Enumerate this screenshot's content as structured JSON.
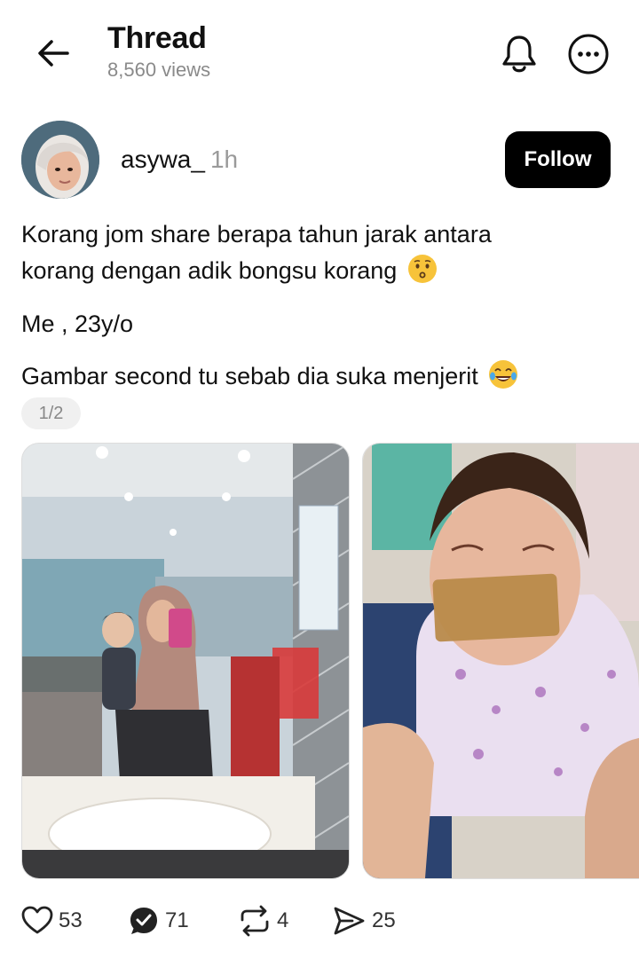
{
  "header": {
    "title": "Thread",
    "views": "8,560 views"
  },
  "author": {
    "username": "asywa_",
    "time": "1h",
    "follow_label": "Follow"
  },
  "post": {
    "line1": "Korang jom share berapa tahun jarak antara",
    "line2": "korang dengan adik bongsu korang",
    "line3": "Me , 23y/o",
    "line4": "Gambar second tu sebab dia suka menjerit",
    "image_counter": "1/2"
  },
  "actions": {
    "likes": "53",
    "replies": "71",
    "reposts": "4",
    "shares": "25"
  },
  "icons": [
    "back-arrow-icon",
    "bell-icon",
    "more-icon",
    "kissing-emoji-icon",
    "laughing-emoji-icon",
    "heart-icon",
    "reply-icon",
    "repost-icon",
    "share-icon"
  ],
  "colors": {
    "follow_bg": "#000000",
    "muted": "#8a8a8a"
  }
}
